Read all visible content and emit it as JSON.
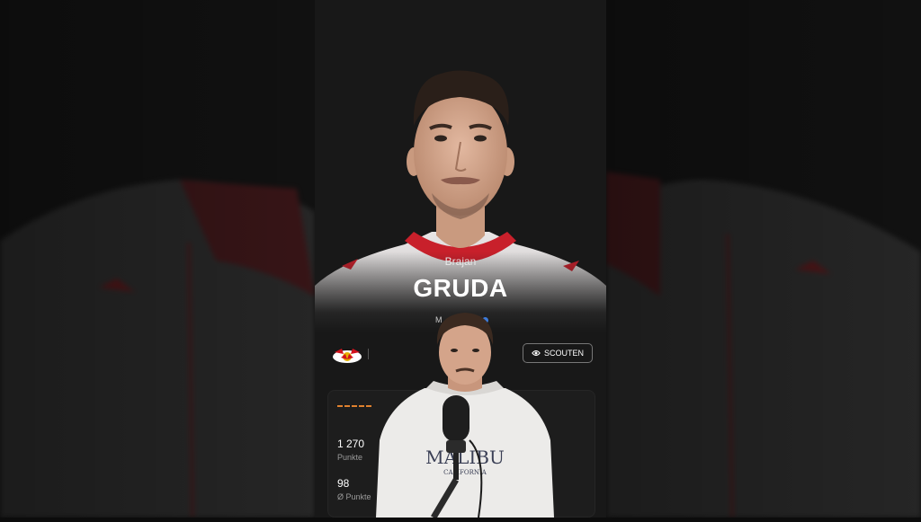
{
  "player": {
    "first_name": "Brajan",
    "last_name": "GRUDA",
    "position_code": "M"
  },
  "actions": {
    "scout_label": "SCOUTEN"
  },
  "stats": [
    {
      "value": "1 270",
      "label": "Punkte"
    },
    {
      "value": "98",
      "label": "Ø Punkte"
    }
  ],
  "colors": {
    "accent_orange": "#e0812e",
    "badge_blue": "#3d7bd9",
    "panel_bg": "#181818",
    "jersey_red": "#c8202b"
  },
  "icons": {
    "scout": "eye-icon",
    "club": "rb-leipzig-crest-icon"
  }
}
